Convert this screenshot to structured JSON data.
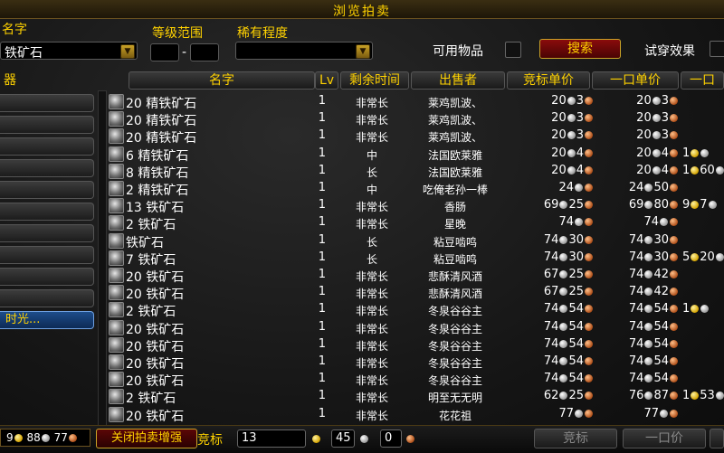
{
  "window": {
    "title": "浏览拍卖"
  },
  "filters": {
    "name_label": "名字",
    "name_value": "铁矿石",
    "level_label": "等级范围",
    "level_min": "",
    "level_sep": "-",
    "level_max": "",
    "rarity_label": "稀有程度",
    "rarity_value": "",
    "usable_label": "可用物品",
    "search_button": "搜索",
    "preview_label": "试穿效果"
  },
  "categories": {
    "header": "器",
    "items": [
      "",
      "",
      "",
      "",
      "",
      "",
      "",
      "",
      "",
      "",
      ""
    ],
    "selected_label": "时光..."
  },
  "columns": {
    "name": "名字",
    "lv": "Lv",
    "time": "剩余时间",
    "seller": "出售者",
    "bid": "竞标单价",
    "buyout": "一口单价",
    "extra": "一口"
  },
  "rows": [
    {
      "name": "20 精铁矿石",
      "lv": "1",
      "time": "非常长",
      "seller": "莱鸡凯波、",
      "bid": [
        "20",
        "3"
      ],
      "buy": [
        "20",
        "3"
      ],
      "extra": []
    },
    {
      "name": "20 精铁矿石",
      "lv": "1",
      "time": "非常长",
      "seller": "莱鸡凯波、",
      "bid": [
        "20",
        "3"
      ],
      "buy": [
        "20",
        "3"
      ],
      "extra": []
    },
    {
      "name": "20 精铁矿石",
      "lv": "1",
      "time": "非常长",
      "seller": "莱鸡凯波、",
      "bid": [
        "20",
        "3"
      ],
      "buy": [
        "20",
        "3"
      ],
      "extra": []
    },
    {
      "name": "6 精铁矿石",
      "lv": "1",
      "time": "中",
      "seller": "法国欧莱雅",
      "bid": [
        "20",
        "4"
      ],
      "buy": [
        "20",
        "4"
      ],
      "extra": [
        "1",
        ""
      ]
    },
    {
      "name": "8 精铁矿石",
      "lv": "1",
      "time": "长",
      "seller": "法国欧莱雅",
      "bid": [
        "20",
        "4"
      ],
      "buy": [
        "20",
        "4"
      ],
      "extra": [
        "1",
        "60"
      ]
    },
    {
      "name": "2 精铁矿石",
      "lv": "1",
      "time": "中",
      "seller": "吃俺老孙一棒",
      "bid": [
        "24",
        ""
      ],
      "buy": [
        "24",
        "50"
      ],
      "extra": []
    },
    {
      "name": "13 铁矿石",
      "lv": "1",
      "time": "非常长",
      "seller": "香肠",
      "bid": [
        "69",
        "25"
      ],
      "buy": [
        "69",
        "80"
      ],
      "extra": [
        "9",
        "7"
      ]
    },
    {
      "name": "2 铁矿石",
      "lv": "1",
      "time": "非常长",
      "seller": "星晚",
      "bid": [
        "74",
        ""
      ],
      "buy": [
        "74",
        ""
      ],
      "extra": []
    },
    {
      "name": "铁矿石",
      "lv": "1",
      "time": "长",
      "seller": "粘豆啮鸣",
      "bid": [
        "74",
        "30"
      ],
      "buy": [
        "74",
        "30"
      ],
      "extra": []
    },
    {
      "name": "7 铁矿石",
      "lv": "1",
      "time": "长",
      "seller": "粘豆啮鸣",
      "bid": [
        "74",
        "30"
      ],
      "buy": [
        "74",
        "30"
      ],
      "extra": [
        "5",
        "20"
      ]
    },
    {
      "name": "20 铁矿石",
      "lv": "1",
      "time": "非常长",
      "seller": "悲酥清风酒",
      "bid": [
        "67",
        "25"
      ],
      "buy": [
        "74",
        "42"
      ],
      "extra": []
    },
    {
      "name": "20 铁矿石",
      "lv": "1",
      "time": "非常长",
      "seller": "悲酥清风酒",
      "bid": [
        "67",
        "25"
      ],
      "buy": [
        "74",
        "42"
      ],
      "extra": []
    },
    {
      "name": "2 铁矿石",
      "lv": "1",
      "time": "非常长",
      "seller": "冬泉谷谷主",
      "bid": [
        "74",
        "54"
      ],
      "buy": [
        "74",
        "54"
      ],
      "extra": [
        "1",
        ""
      ]
    },
    {
      "name": "20 铁矿石",
      "lv": "1",
      "time": "非常长",
      "seller": "冬泉谷谷主",
      "bid": [
        "74",
        "54"
      ],
      "buy": [
        "74",
        "54"
      ],
      "extra": []
    },
    {
      "name": "20 铁矿石",
      "lv": "1",
      "time": "非常长",
      "seller": "冬泉谷谷主",
      "bid": [
        "74",
        "54"
      ],
      "buy": [
        "74",
        "54"
      ],
      "extra": []
    },
    {
      "name": "20 铁矿石",
      "lv": "1",
      "time": "非常长",
      "seller": "冬泉谷谷主",
      "bid": [
        "74",
        "54"
      ],
      "buy": [
        "74",
        "54"
      ],
      "extra": []
    },
    {
      "name": "20 铁矿石",
      "lv": "1",
      "time": "非常长",
      "seller": "冬泉谷谷主",
      "bid": [
        "74",
        "54"
      ],
      "buy": [
        "74",
        "54"
      ],
      "extra": []
    },
    {
      "name": "2 铁矿石",
      "lv": "1",
      "time": "非常长",
      "seller": "明至无无明",
      "bid": [
        "62",
        "25"
      ],
      "buy": [
        "76",
        "87"
      ],
      "extra": [
        "1",
        "53"
      ]
    },
    {
      "name": "20 铁矿石",
      "lv": "1",
      "time": "非常长",
      "seller": "花花祖",
      "bid": [
        "77",
        ""
      ],
      "buy": [
        "77",
        ""
      ],
      "extra": []
    }
  ],
  "bottom": {
    "money_silver": "88",
    "money_copper": "77",
    "money_gold": "9",
    "close_button": "关闭拍卖增强",
    "bid_label": "竞标",
    "bid_gold": "13",
    "bid_silver": "45",
    "bid_copper": "0",
    "bid_button": "竞标",
    "buyout_button": "一口价"
  }
}
